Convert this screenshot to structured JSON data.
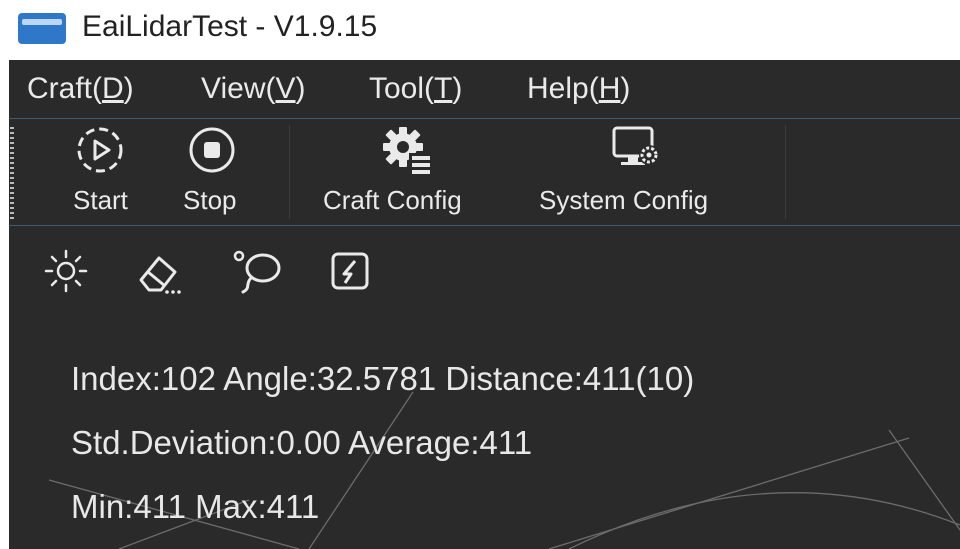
{
  "window": {
    "title": "EaiLidarTest - V1.9.15",
    "app_icon": "app-logo-icon"
  },
  "menu": [
    {
      "label": "Craft(",
      "key": "D",
      "suffix": ")"
    },
    {
      "label": "View(",
      "key": "V",
      "suffix": ")"
    },
    {
      "label": "Tool(",
      "key": "T",
      "suffix": ")"
    },
    {
      "label": "Help(",
      "key": "H",
      "suffix": ")"
    }
  ],
  "toolbar": {
    "start_label": "Start",
    "stop_label": "Stop",
    "craft_config_label": "Craft Config",
    "system_config_label": "System Config",
    "icons": [
      "play-circle-icon",
      "stop-circle-icon",
      "gear-list-icon",
      "monitor-gear-icon"
    ]
  },
  "quick_tools": [
    "brightness-icon",
    "eraser-icon",
    "lasso-icon",
    "edit-square-icon"
  ],
  "info": {
    "line1": "Index:102 Angle:32.5781 Distance:411(10)",
    "line2": "Std.Deviation:0.00 Average:411",
    "line3": "Min:411 Max:411"
  },
  "colors": {
    "background": "#2a2a2a",
    "text": "#eaeaea",
    "accent_border": "#3c5a70",
    "app_icon": "#2f77c8"
  }
}
